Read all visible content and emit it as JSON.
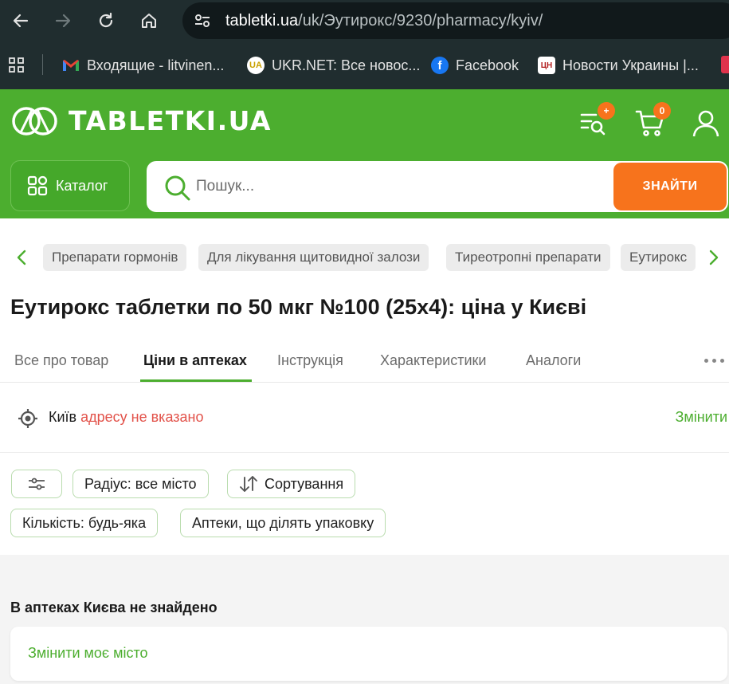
{
  "browser": {
    "url_host": "tabletki.ua",
    "url_path": "/uk/Эутирокс/9230/pharmacy/kyiv/",
    "bookmarks": [
      {
        "label": "Входящие - litvinen...",
        "icon": "gmail-icon"
      },
      {
        "label": "UKR.NET: Все новос...",
        "icon": "ukrnet-icon"
      },
      {
        "label": "Facebook",
        "icon": "facebook-icon"
      },
      {
        "label": "Новости Украины |...",
        "icon": "tsn-icon"
      }
    ]
  },
  "site": {
    "logo_text": "TABLETKI.UA",
    "wishlist_badge": "+",
    "cart_badge": "0",
    "catalog_label": "Каталог",
    "search_placeholder": "Пошук...",
    "search_button": "ЗНАЙТИ",
    "brand_color": "#4cae2f",
    "accent_color": "#f7731c"
  },
  "breadcrumbs": [
    "Препарати гормонів",
    "Для лікування щитовидної залози",
    "Тиреотропні препарати",
    "Еутирокс"
  ],
  "product": {
    "title": "Еутирокс таблетки по 50 мкг №100 (25x4): ціна у Києві"
  },
  "tabs": [
    {
      "label": "Все про товар",
      "active": false
    },
    {
      "label": "Ціни в аптеках",
      "active": true
    },
    {
      "label": "Інструкція",
      "active": false
    },
    {
      "label": "Характеристики",
      "active": false
    },
    {
      "label": "Аналоги",
      "active": false
    }
  ],
  "location": {
    "city": "Київ",
    "address_status": "адресу не вказано",
    "change_label": "Змінити"
  },
  "filters": {
    "radius": "Радіус: все місто",
    "sort": "Сортування",
    "quantity": "Кількість: будь-яка",
    "pharmacies": "Аптеки, що ділять упаковку"
  },
  "results": {
    "not_found": "В аптеках Києва не знайдено",
    "change_city": "Змінити моє місто"
  }
}
